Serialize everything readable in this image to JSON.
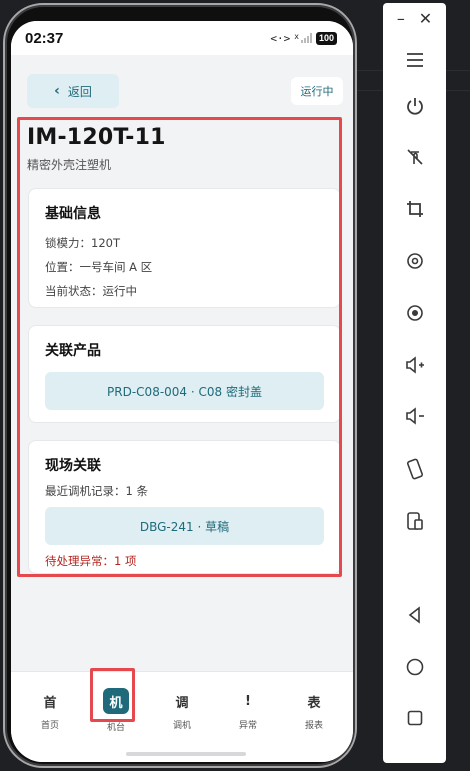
{
  "statusbar": {
    "time": "02:37",
    "data_icon": "<·>",
    "signal_mark": "x",
    "battery": "100"
  },
  "header": {
    "back_label": "返回",
    "status_chip": "运行中"
  },
  "machine": {
    "title": "IM-120T-11",
    "subtitle": "精密外壳注塑机"
  },
  "basic_info": {
    "title": "基础信息",
    "rows": [
      "锁模力：120T",
      "位置：一号车间 A 区",
      "当前状态：运行中"
    ]
  },
  "related_product": {
    "title": "关联产品",
    "product_button": "PRD-C08-004 · C08 密封盖"
  },
  "field_link": {
    "title": "现场关联",
    "recent_record": "最近调机记录：1 条",
    "record_button": "DBG-241 · 草稿",
    "pending_issues": "待处理异常：1 项"
  },
  "bottom_nav": {
    "items": [
      {
        "glyph": "首",
        "label": "首页",
        "active": false
      },
      {
        "glyph": "机",
        "label": "机台",
        "active": true
      },
      {
        "glyph": "调",
        "label": "调机",
        "active": false
      },
      {
        "glyph": "!",
        "label": "异常",
        "active": false
      },
      {
        "glyph": "表",
        "label": "报表",
        "active": false
      }
    ]
  },
  "toolbar": {
    "icons": [
      "menu-icon",
      "power-icon",
      "touch-off-icon",
      "crop-icon",
      "rotate-icon",
      "screen-record-icon",
      "volume-up-icon",
      "volume-down-icon",
      "rotate-device-icon",
      "screenshot-icon",
      "back-icon",
      "home-icon",
      "overview-icon"
    ]
  },
  "colors": {
    "accent": "#1f6a7a",
    "accent_soft": "#dfeef2",
    "warning": "#b3261e",
    "highlight": "#e5484d"
  }
}
